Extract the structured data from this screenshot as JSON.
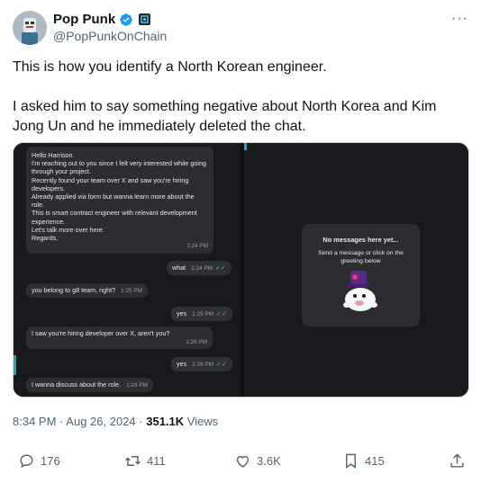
{
  "author": {
    "name": "Pop Punk",
    "handle": "@PopPunkOnChain"
  },
  "tweet": {
    "paragraph_1": "This is how you identify a North Korean engineer.",
    "paragraph_2": "I asked him to say something negative about North Korea and Kim Jong Un and he immediately deleted the chat."
  },
  "screenshot": {
    "messages": [
      {
        "text": "Hello Harrison.\nI'm reaching out to you since I felt very interested while going through your project.\nRecently found your team over X and saw you're hiring developers.\nAlready applied via form but wanna learn more about the role.\nThis is smart contract engineer with relevant development experience.\nLet's talk more over here.\nRegards,",
        "time": "1:24 PM"
      },
      {
        "text": "what",
        "time": "1:24 PM"
      },
      {
        "text": "you belong to g8 team, right?",
        "time": "1:25 PM"
      },
      {
        "text": "yes",
        "time": "1:25 PM"
      },
      {
        "text": "I saw you're hiring developer over X, aren't you?",
        "time": "1:26 PM"
      },
      {
        "text": "yes",
        "time": "1:26 PM"
      },
      {
        "text": "I wanna discuss about the role.",
        "time": "1:29 PM"
      }
    ],
    "empty_title": "No messages here yet...",
    "empty_subtitle": "Send a message or click on the greeting below"
  },
  "meta": {
    "time": "8:34 PM",
    "sep1": "·",
    "date": "Aug 26, 2024",
    "sep2": "·",
    "views_count": "351.1K",
    "views_label": "Views"
  },
  "actions": {
    "replies": "176",
    "reposts": "411",
    "likes": "3.6K",
    "bookmarks": "415"
  },
  "colors": {
    "verified": "#1d9bf0",
    "text_primary": "#0f1419",
    "text_secondary": "#536471",
    "chat_bg": "#17191c",
    "bubble_bg": "#2b2d31",
    "accent": "#21a5b7"
  },
  "icons": [
    "more-icon",
    "verified-icon",
    "affiliate-badge-icon",
    "reply-icon",
    "repost-icon",
    "like-icon",
    "bookmark-icon",
    "share-icon",
    "read-check-icon"
  ]
}
